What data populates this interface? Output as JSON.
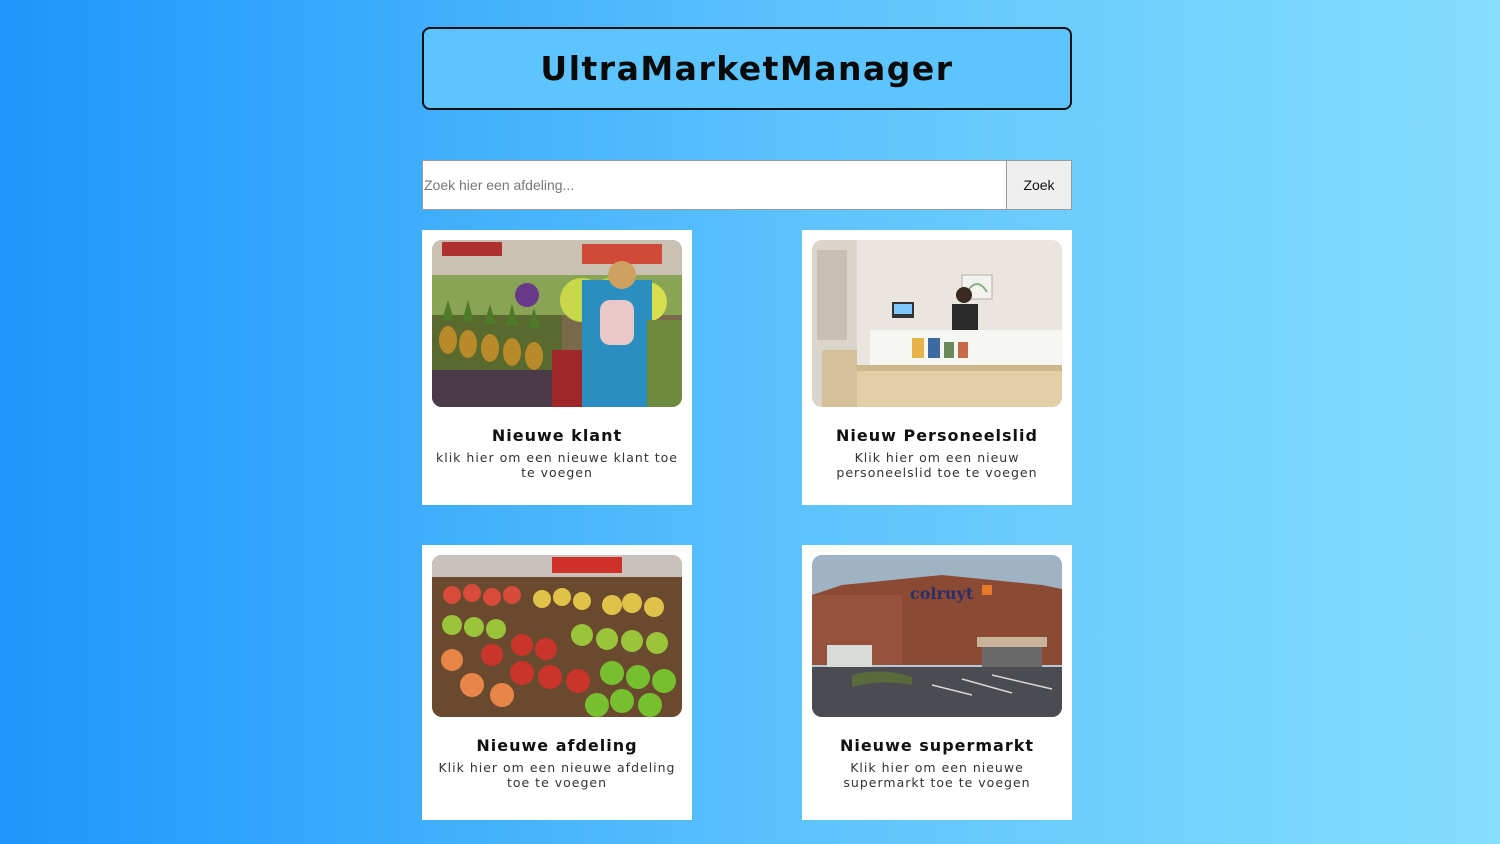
{
  "header": {
    "title": "UltraMarketManager"
  },
  "search": {
    "placeholder": "Zoek hier een afdeling...",
    "value": "",
    "button_label": "Zoek"
  },
  "cards": [
    {
      "title": "Nieuwe klant",
      "description": "klik hier om een nieuwe klant toe te voegen",
      "image": "shopper-in-fruit-aisle"
    },
    {
      "title": "Nieuw Personeelslid",
      "description": "Klik hier om een nieuw personeelslid toe te voegen",
      "image": "shop-employee-at-counter"
    },
    {
      "title": "Nieuwe afdeling",
      "description": "Klik hier om een nieuwe afdeling toe te voegen",
      "image": "apple-display"
    },
    {
      "title": "Nieuwe supermarkt",
      "description": "Klik hier om een nieuwe supermarkt toe te voegen",
      "image": "supermarket-building",
      "sign_text": "colruyt"
    }
  ]
}
